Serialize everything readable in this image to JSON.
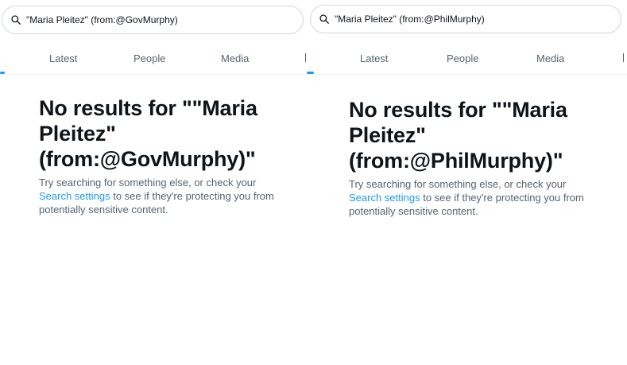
{
  "panels": [
    {
      "search_query": "\"Maria Pleitez\" (from:@GovMurphy)",
      "tabs": [
        "Latest",
        "People",
        "Media"
      ],
      "empty_title": "No results for \"\"Maria Pleitez\" (from:@GovMurphy)\"",
      "empty_desc_before": "Try searching for something else, or check your ",
      "empty_link": "Search settings",
      "empty_desc_after": " to see if they're protecting you from potentially sensitive content."
    },
    {
      "search_query": "\"Maria Pleitez\" (from:@PhilMurphy)",
      "tabs": [
        "Latest",
        "People",
        "Media"
      ],
      "empty_title": "No results for \"\"Maria Pleitez\" (from:@PhilMurphy)\"",
      "empty_desc_before": "Try searching for something else, or check your ",
      "empty_link": "Search settings",
      "empty_desc_after": " to see if they're protecting you from potentially sensitive content."
    }
  ],
  "colors": {
    "accent": "#1d9bf0",
    "text": "#0f1419",
    "muted": "#536471",
    "border": "#cfd9de"
  },
  "icons": {
    "search": "search-icon"
  }
}
